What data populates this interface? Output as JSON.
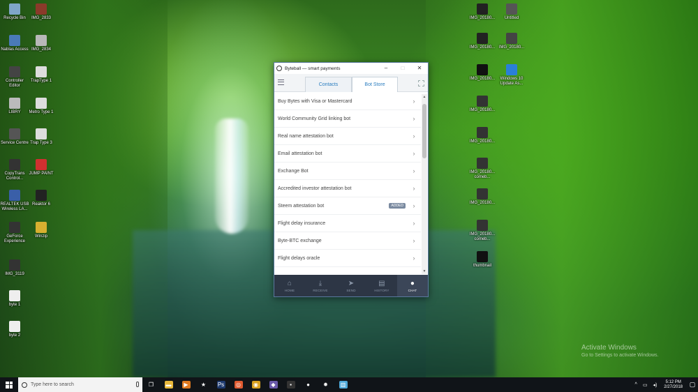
{
  "desktop_icons": [
    {
      "label": "Recycle Bin",
      "icon": "recycle-bin-icon",
      "color": "#7fa6c8"
    },
    {
      "label": "IMG_2833",
      "icon": "image-file-icon",
      "color": "#8a3a2a"
    },
    {
      "label": "Nablas Access",
      "icon": "app-icon",
      "color": "#4a7ab8"
    },
    {
      "label": "IMG_2834",
      "icon": "image-file-icon",
      "color": "#b8b8b8"
    },
    {
      "label": "Controller Editor",
      "icon": "controller-icon",
      "color": "#444444"
    },
    {
      "label": "TrapType 1",
      "icon": "document-icon",
      "color": "#dddddd"
    },
    {
      "label": "LIBRY",
      "icon": "app-icon",
      "color": "#bbbbbb"
    },
    {
      "label": "Metro Type 1",
      "icon": "document-icon",
      "color": "#dddddd"
    },
    {
      "label": "Service Centre",
      "icon": "gear-icon",
      "color": "#555555"
    },
    {
      "label": "Trap Type 3",
      "icon": "document-icon",
      "color": "#dddddd"
    },
    {
      "label": "CopyTrans Control...",
      "icon": "app-icon",
      "color": "#333333"
    },
    {
      "label": "JUMP PAINT",
      "icon": "paint-icon",
      "color": "#d03030"
    },
    {
      "label": "REALTEK USB Wireless LA...",
      "icon": "network-icon",
      "color": "#3a5fa8"
    },
    {
      "label": "Reaktor 6",
      "icon": "app-icon",
      "color": "#222222"
    },
    {
      "label": "GeForce Experience",
      "icon": "app-icon",
      "color": "#333333"
    },
    {
      "label": "Winzip",
      "icon": "archive-icon",
      "color": "#d8b030"
    },
    {
      "label": "IMG_3119",
      "icon": "image-file-icon",
      "color": "#333333"
    },
    {
      "label": "byte 1",
      "icon": "document-icon",
      "color": "#eeeeee"
    },
    {
      "label": "byte 2",
      "icon": "document-icon",
      "color": "#eeeeee"
    },
    {
      "label": "IMG_20180...",
      "icon": "image-file-icon",
      "color": "#222222"
    },
    {
      "label": "Untitled",
      "icon": "image-file-icon",
      "color": "#555555"
    },
    {
      "label": "IMG_20180...",
      "icon": "image-file-icon",
      "color": "#222222"
    },
    {
      "label": "IMG_20180...",
      "icon": "image-file-icon",
      "color": "#444444"
    },
    {
      "label": "IMG_20180...",
      "icon": "image-file-icon",
      "color": "#111111"
    },
    {
      "label": "Windows 10 Update As...",
      "icon": "windows-update-icon",
      "color": "#2a7fd8"
    },
    {
      "label": "IMG_20180...",
      "icon": "image-file-icon",
      "color": "#333333"
    },
    {
      "label": "IMG_20180...",
      "icon": "image-file-icon",
      "color": "#333333"
    },
    {
      "label": "IMG_20180... comeb...",
      "icon": "image-file-icon",
      "color": "#333333"
    },
    {
      "label": "IMG_20180...",
      "icon": "image-file-icon",
      "color": "#333333"
    },
    {
      "label": "IMG_20180... comeb...",
      "icon": "image-file-icon",
      "color": "#333333"
    },
    {
      "label": "thumbnail",
      "icon": "image-file-icon",
      "color": "#111111"
    }
  ],
  "app": {
    "title": "Byteball — smart payments",
    "window_buttons": {
      "minimize": "–",
      "maximize": "□",
      "close": "✕"
    },
    "tabs": [
      {
        "label": "Contacts",
        "active": false
      },
      {
        "label": "Bot Store",
        "active": true
      }
    ],
    "bots": [
      {
        "name": "Buy Bytes with Visa or Mastercard",
        "badge": ""
      },
      {
        "name": "World Community Grid linking bot",
        "badge": ""
      },
      {
        "name": "Real name attestation bot",
        "badge": ""
      },
      {
        "name": "Email attestation bot",
        "badge": ""
      },
      {
        "name": "Exchange Bot",
        "badge": ""
      },
      {
        "name": "Accredited investor attestation bot",
        "badge": ""
      },
      {
        "name": "Steem attestation bot",
        "badge": "ADDED"
      },
      {
        "name": "Flight delay insurance",
        "badge": ""
      },
      {
        "name": "Byte-BTC exchange",
        "badge": ""
      },
      {
        "name": "Flight delays oracle",
        "badge": ""
      }
    ],
    "nav": [
      {
        "label": "HOME",
        "icon": "home-icon",
        "glyph": "⌂",
        "active": false
      },
      {
        "label": "RECEIVE",
        "icon": "receive-icon",
        "glyph": "⤓",
        "active": false
      },
      {
        "label": "SEND",
        "icon": "send-icon",
        "glyph": "➤",
        "active": false
      },
      {
        "label": "HISTORY",
        "icon": "history-icon",
        "glyph": "▤",
        "active": false
      },
      {
        "label": "CHAT",
        "icon": "chat-icon",
        "glyph": "●",
        "active": true
      }
    ],
    "accent_color": "#2b7dbf",
    "nav_bg": "#2d3645"
  },
  "activation": {
    "title": "Activate Windows",
    "subtitle": "Go to Settings to activate Windows."
  },
  "taskbar": {
    "search_placeholder": "Type here to search",
    "apps": [
      {
        "name": "task-view-icon",
        "glyph": "❐",
        "color": "#101418"
      },
      {
        "name": "file-explorer-icon",
        "glyph": "▬",
        "color": "#e8b83a"
      },
      {
        "name": "media-player-icon",
        "glyph": "▶",
        "color": "#e07a20"
      },
      {
        "name": "star-app-icon",
        "glyph": "★",
        "color": "#101418"
      },
      {
        "name": "photoshop-icon",
        "glyph": "Ps",
        "color": "#1e3a6e"
      },
      {
        "name": "circle-app-icon",
        "glyph": "◎",
        "color": "#e05a30"
      },
      {
        "name": "chrome-icon",
        "glyph": "◉",
        "color": "#d8a020"
      },
      {
        "name": "purple-app-icon",
        "glyph": "◆",
        "color": "#6a5aa8"
      },
      {
        "name": "camera-app-icon",
        "glyph": "▪",
        "color": "#333333"
      },
      {
        "name": "byteball-icon",
        "glyph": "●",
        "color": "#101418"
      },
      {
        "name": "settings-icon",
        "glyph": "✹",
        "color": "#101418"
      },
      {
        "name": "notepad-icon",
        "glyph": "▥",
        "color": "#4ea8d8"
      }
    ],
    "time": "5:12 PM",
    "date": "2/27/2018"
  }
}
